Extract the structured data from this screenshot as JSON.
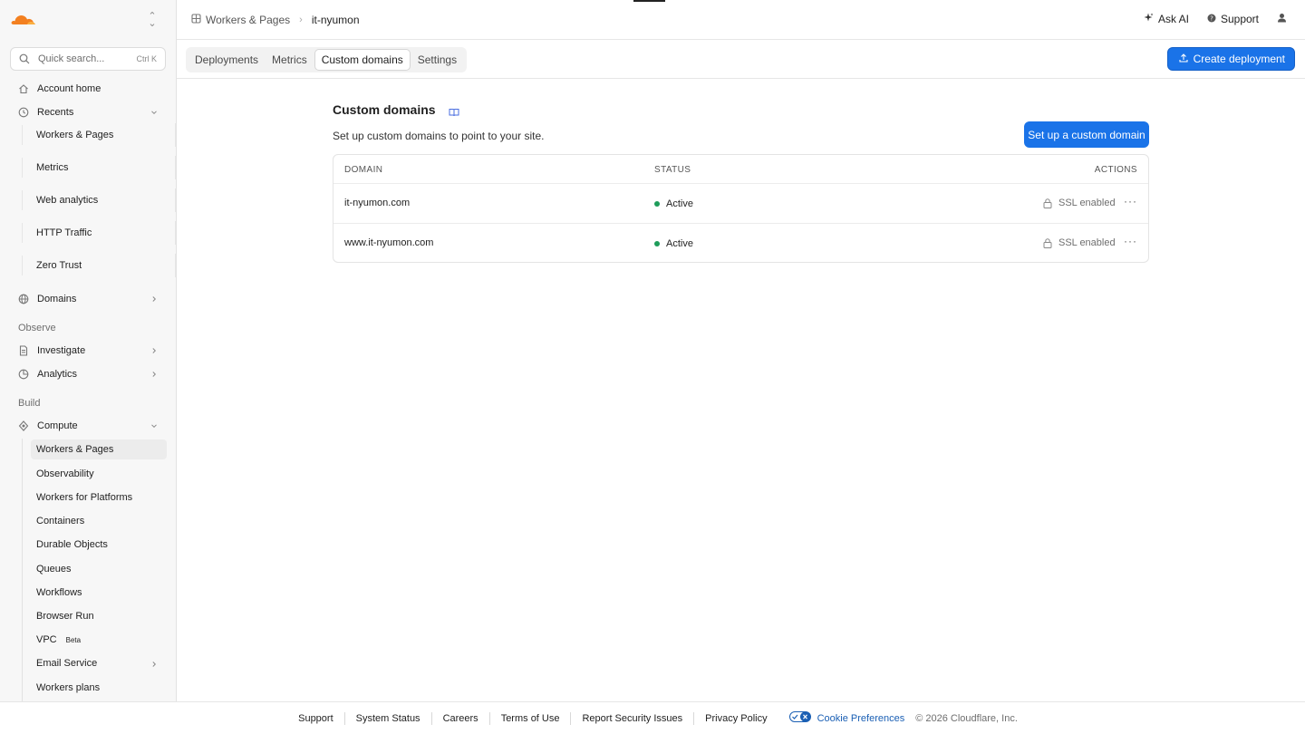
{
  "sidebar": {
    "search": {
      "placeholder": "Quick search...",
      "shortcut": "Ctrl K"
    },
    "account_home": "Account home",
    "recents": {
      "label": "Recents",
      "items": [
        "Workers & Pages",
        "Metrics",
        "Web analytics",
        "HTTP Traffic",
        "Zero Trust"
      ]
    },
    "domains": "Domains",
    "observe_label": "Observe",
    "investigate": "Investigate",
    "analytics": "Analytics",
    "build_label": "Build",
    "compute": {
      "label": "Compute",
      "items": [
        "Workers & Pages",
        "Observability",
        "Workers for Platforms",
        "Containers",
        "Durable Objects",
        "Queues",
        "Workflows",
        "Browser Run",
        "VPC",
        "Email Service",
        "Workers plans"
      ],
      "vpc_badge": "Beta"
    }
  },
  "header": {
    "breadcrumb": [
      "Workers & Pages",
      "it-nyumon"
    ],
    "ask_ai": "Ask AI",
    "support": "Support"
  },
  "tabs": {
    "items": [
      "Deployments",
      "Metrics",
      "Custom domains",
      "Settings"
    ],
    "active": "Custom domains"
  },
  "create_deployment": "Create deployment",
  "main": {
    "title": "Custom domains",
    "description": "Set up custom domains to point to your site.",
    "setup_button": "Set up a custom domain",
    "columns": [
      "DOMAIN",
      "STATUS",
      "ACTIONS"
    ],
    "rows": [
      {
        "domain": "it-nyumon.com",
        "status": "Active",
        "ssl": "SSL enabled"
      },
      {
        "domain": "www.it-nyumon.com",
        "status": "Active",
        "ssl": "SSL enabled"
      }
    ]
  },
  "footer": {
    "links": [
      "Support",
      "System Status",
      "Careers",
      "Terms of Use",
      "Report Security Issues",
      "Privacy Policy"
    ],
    "cookie": "Cookie Preferences",
    "copyright": "© 2026 Cloudflare, Inc."
  },
  "colors": {
    "accent": "#1a73e8",
    "status_active": "#1e9c5a",
    "brand_orange": "#f38020"
  }
}
